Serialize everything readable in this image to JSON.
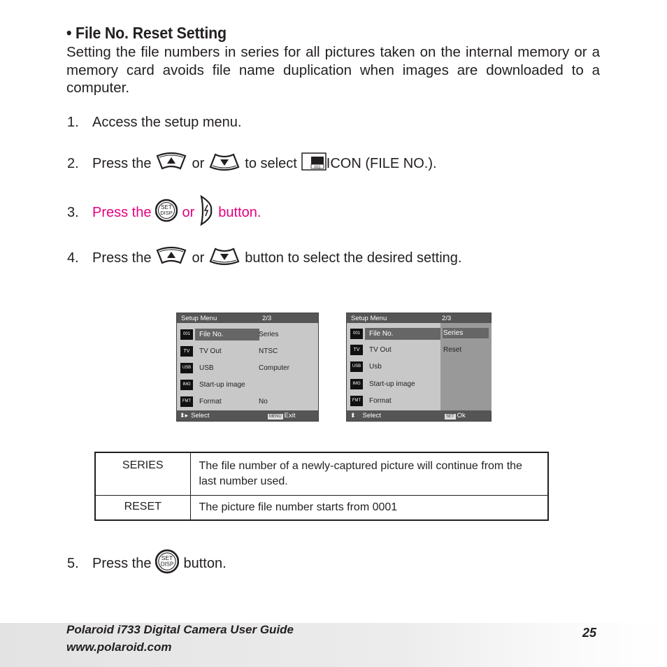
{
  "heading": "• File No. Reset Setting",
  "intro": "Setting the file numbers in series for all pictures taken on the internal memory or a memory card avoids file name duplication when images are downloaded to a computer.",
  "steps": [
    {
      "num": "1.",
      "text": "Access the setup menu."
    },
    {
      "num": "2.",
      "pre": "Press the",
      "or": "or",
      "mid": "to select",
      "post": "ICON (FILE NO.)."
    },
    {
      "num": "3.",
      "pre": "Press the",
      "or": "or",
      "post": "button.",
      "color": "#e6007e"
    },
    {
      "num": "4.",
      "pre": "Press the",
      "or": "or",
      "post": "button to select the desired setting."
    },
    {
      "num": "5.",
      "pre": "Press the",
      "post": "button."
    }
  ],
  "icons": {
    "up": "up-button-icon",
    "down": "down-button-icon",
    "set_disp": "set-disp-button-icon",
    "flash": "flash-right-button-icon",
    "file_no": "file-no-icon",
    "set_label_top": "SET",
    "set_label_bottom": "DISP",
    "file_no_label": "001"
  },
  "screen1": {
    "title": "Setup Menu",
    "page": "2/3",
    "rows": [
      {
        "label": "File No.",
        "value": "Series",
        "icon": "001"
      },
      {
        "label": "TV Out",
        "value": "NTSC",
        "icon": "TV"
      },
      {
        "label": "USB",
        "value": "Computer",
        "icon": "USB"
      },
      {
        "label": "Start-up image",
        "value": "",
        "icon": "IMG"
      },
      {
        "label": "Format",
        "value": "No",
        "icon": "FMT"
      }
    ],
    "footer_left": "Select",
    "footer_tag": "MENU",
    "footer_right": "Exit"
  },
  "screen2": {
    "title": "Setup Menu",
    "page": "2/3",
    "rows": [
      {
        "label": "File No.",
        "icon": "001"
      },
      {
        "label": "TV Out",
        "icon": "TV"
      },
      {
        "label": "Usb",
        "icon": "USB"
      },
      {
        "label": "Start-up image",
        "icon": "IMG"
      },
      {
        "label": "Format",
        "icon": "FMT"
      }
    ],
    "options": [
      "Series",
      "Reset"
    ],
    "footer_left": "Select",
    "footer_tag": "SET",
    "footer_right": "Ok"
  },
  "table": [
    {
      "key": "SERIES",
      "desc": "The file number of a newly-captured picture will continue from the last number used."
    },
    {
      "key": "RESET",
      "desc": "The picture file number starts from 0001"
    }
  ],
  "footer": {
    "guide": "Polaroid i733 Digital Camera User Guide",
    "url": "www.polaroid.com",
    "page": "25"
  }
}
